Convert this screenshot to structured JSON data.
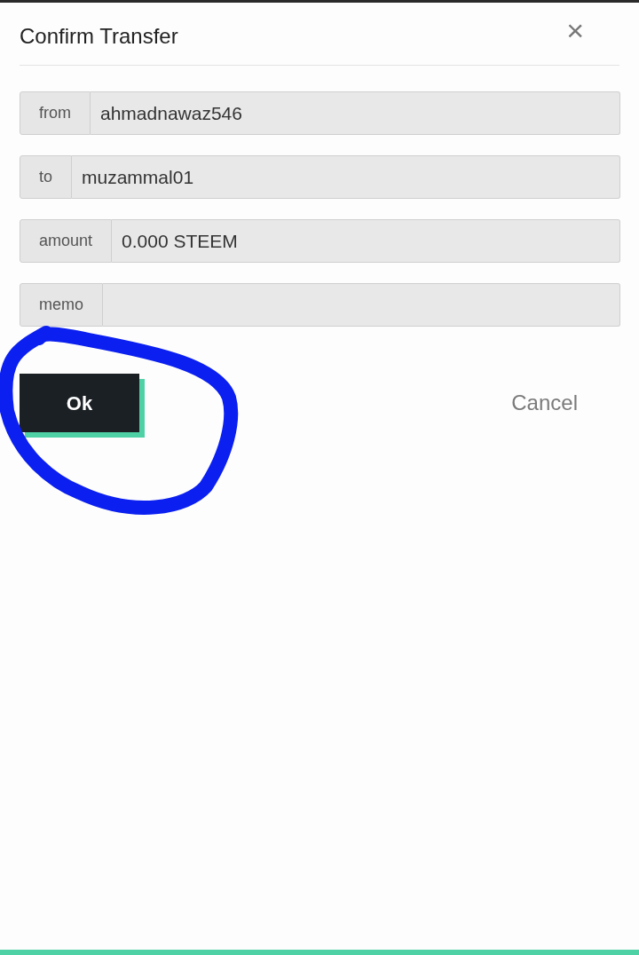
{
  "dialog": {
    "title": "Confirm Transfer",
    "close": "×"
  },
  "fields": [
    {
      "label": "from",
      "value": "ahmadnawaz546"
    },
    {
      "label": "to",
      "value": "muzammal01"
    },
    {
      "label": "amount",
      "value": "0.000 STEEM"
    },
    {
      "label": "memo"
    }
  ],
  "buttons": {
    "ok": "Ok",
    "cancel": "Cancel"
  }
}
